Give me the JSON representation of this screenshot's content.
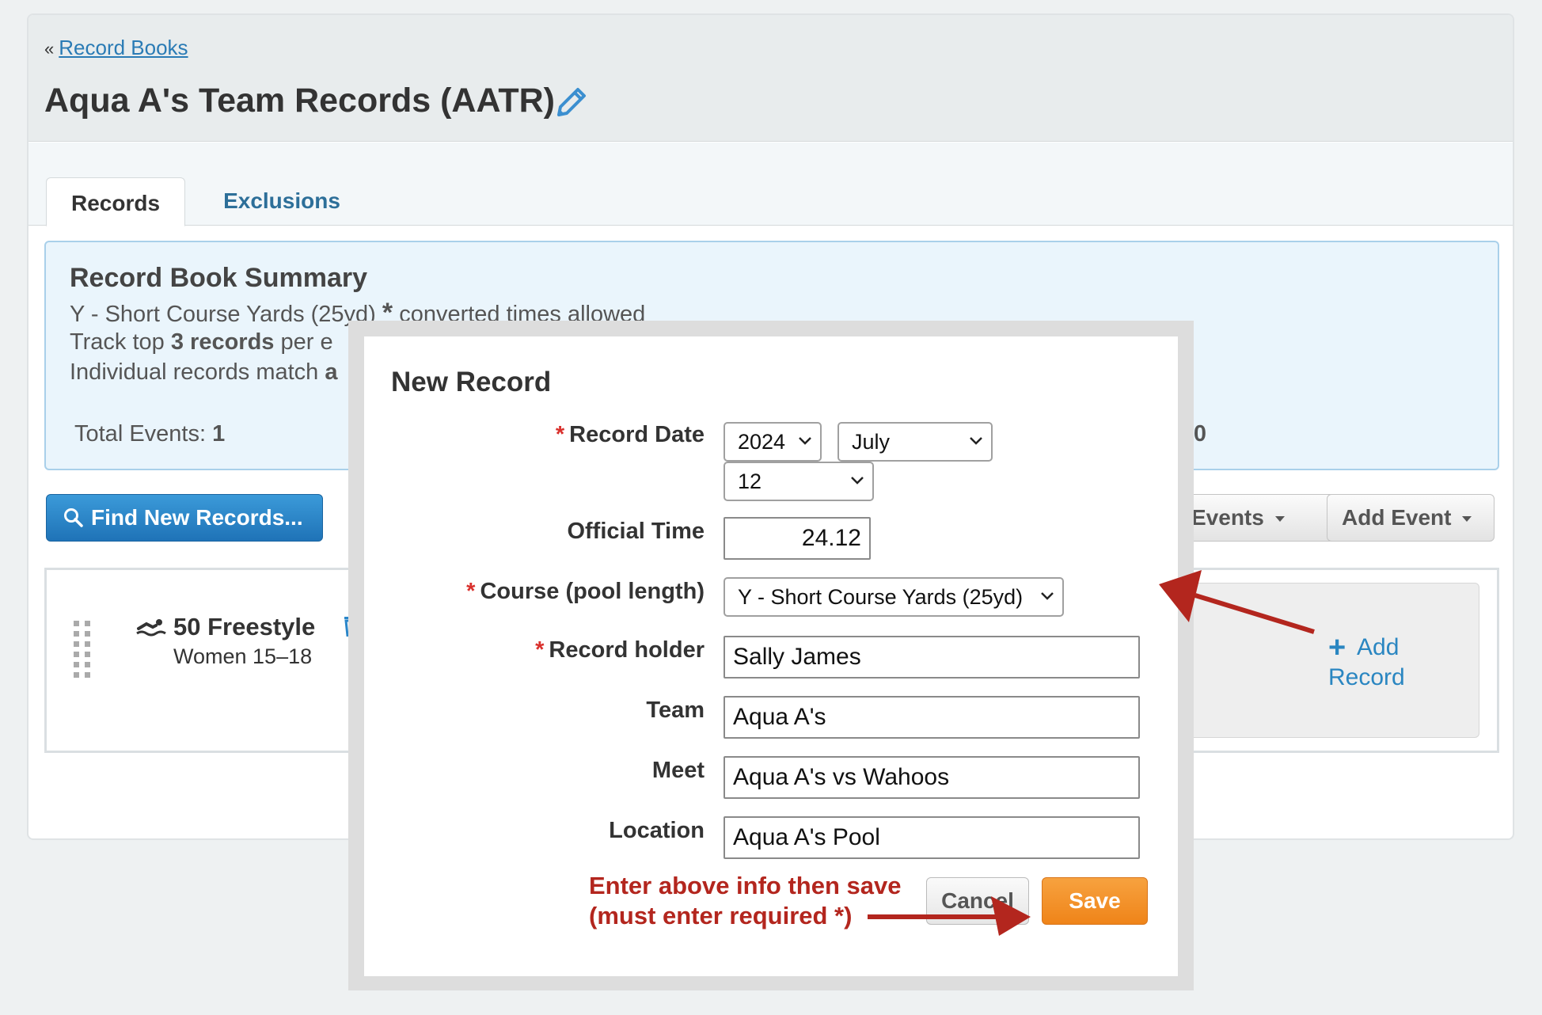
{
  "breadcrumb": {
    "arrow": "«",
    "link": "Record Books"
  },
  "page": {
    "title": "Aqua A's Team Records (AATR)"
  },
  "tabs": [
    {
      "label": "Records"
    },
    {
      "label": "Exclusions"
    }
  ],
  "summary": {
    "title": "Record Book Summary",
    "course_prefix": "Y - Short Course Yards (25yd)",
    "course_star": "*",
    "course_suffix": "converted times allowed",
    "track_prefix": "Track top",
    "track_bold": "3 records",
    "track_suffix": "per e",
    "match_text": "Individual records match",
    "match_trail": "a",
    "total_label": "Total Events:",
    "total_value": "1",
    "right_fragment": "0"
  },
  "toolbar": {
    "find_label": "Find New Records...",
    "events_label": "Events",
    "add_event_label": "Add Event"
  },
  "event": {
    "name": "50 Freestyle",
    "group": "Women 15–18",
    "add_plus": "+",
    "add_label_1": "Add",
    "add_label_2": "Record"
  },
  "modal": {
    "title": "New Record",
    "required_mark": "*",
    "record_date_label": "Record Date",
    "year": "2024",
    "month": "July",
    "day": "12",
    "official_time_label": "Official Time",
    "official_time": "24.12",
    "course_label": "Course (pool length)",
    "course_value": "Y - Short Course Yards (25yd)",
    "holder_label": "Record holder",
    "holder_value": "Sally James",
    "team_label": "Team",
    "team_value": "Aqua A's",
    "meet_label": "Meet",
    "meet_value": "Aqua A's vs Wahoos",
    "location_label": "Location",
    "location_value": "Aqua A's Pool",
    "hint_line_1": "Enter above info then save",
    "hint_line_2": "(must enter required *)",
    "cancel_label": "Cancel",
    "save_label": "Save"
  },
  "colors": {
    "link": "#2a7bb5",
    "primary_button": "#2a86c9",
    "save_button": "#f39a30",
    "annotation_red": "#b3261e",
    "required": "#d9302c"
  },
  "icons": [
    "pencil-icon",
    "search-icon",
    "swimmer-icon",
    "trash-icon",
    "drag-handle-icon",
    "plus-icon",
    "chevron-down-icon",
    "caret-down-icon",
    "annotation-arrow-icon"
  ]
}
